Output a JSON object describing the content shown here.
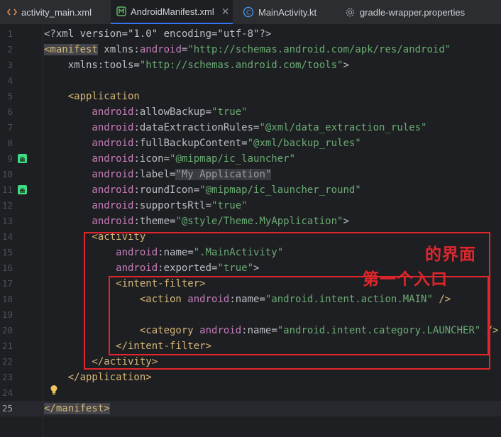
{
  "tabs": [
    {
      "label": "activity_main.xml",
      "icon": "xml-code-icon"
    },
    {
      "label": "AndroidManifest.xml",
      "icon": "manifest-icon",
      "active": true
    },
    {
      "label": "MainActivity.kt",
      "icon": "kotlin-class-icon"
    },
    {
      "label": "gradle-wrapper.properties",
      "icon": "gear-icon"
    }
  ],
  "editor": {
    "current_line": 25,
    "line_numbers": [
      "1",
      "2",
      "3",
      "4",
      "5",
      "6",
      "7",
      "8",
      "9",
      "10",
      "11",
      "12",
      "13",
      "14",
      "15",
      "16",
      "17",
      "18",
      "19",
      "20",
      "21",
      "22",
      "23",
      "24",
      "25"
    ],
    "lines": [
      [
        {
          "t": "<?xml version=\"1.0\" encoding=\"utf-8\"?>",
          "c": "pi"
        }
      ],
      [
        {
          "t": "<manifest",
          "c": "tag hl"
        },
        {
          "t": " xmlns:",
          "c": "attr"
        },
        {
          "t": "android",
          "c": "ns"
        },
        {
          "t": "=",
          "c": "attr"
        },
        {
          "t": "\"http://schemas.android.com/apk/res/android\"",
          "c": "str"
        }
      ],
      [
        {
          "t": "    xmlns:tools=",
          "c": "attr"
        },
        {
          "t": "\"http://schemas.android.com/tools\"",
          "c": "str"
        },
        {
          "t": ">",
          "c": "br"
        }
      ],
      [],
      [
        {
          "t": "    <application",
          "c": "tag"
        }
      ],
      [
        {
          "t": "        android",
          "c": "ns"
        },
        {
          "t": ":allowBackup=",
          "c": "attr"
        },
        {
          "t": "\"true\"",
          "c": "str"
        }
      ],
      [
        {
          "t": "        android",
          "c": "ns"
        },
        {
          "t": ":dataExtractionRules=",
          "c": "attr"
        },
        {
          "t": "\"@xml/data_extraction_rules\"",
          "c": "str"
        }
      ],
      [
        {
          "t": "        android",
          "c": "ns"
        },
        {
          "t": ":fullBackupContent=",
          "c": "attr"
        },
        {
          "t": "\"@xml/backup_rules\"",
          "c": "str"
        }
      ],
      [
        {
          "t": "        android",
          "c": "ns"
        },
        {
          "t": ":icon=",
          "c": "attr"
        },
        {
          "t": "\"@mipmap/ic_launcher\"",
          "c": "str"
        }
      ],
      [
        {
          "t": "        android",
          "c": "ns"
        },
        {
          "t": ":label=",
          "c": "attr"
        },
        {
          "t": "\"My Application\"",
          "c": "strhl"
        }
      ],
      [
        {
          "t": "        android",
          "c": "ns"
        },
        {
          "t": ":roundIcon=",
          "c": "attr"
        },
        {
          "t": "\"@mipmap/ic_launcher_round\"",
          "c": "str"
        }
      ],
      [
        {
          "t": "        android",
          "c": "ns"
        },
        {
          "t": ":supportsRtl=",
          "c": "attr"
        },
        {
          "t": "\"true\"",
          "c": "str"
        }
      ],
      [
        {
          "t": "        android",
          "c": "ns"
        },
        {
          "t": ":theme=",
          "c": "attr"
        },
        {
          "t": "\"@style/Theme.MyApplication\"",
          "c": "str"
        },
        {
          "t": ">",
          "c": "br"
        }
      ],
      [
        {
          "t": "        <activity",
          "c": "tag"
        }
      ],
      [
        {
          "t": "            android",
          "c": "ns"
        },
        {
          "t": ":name=",
          "c": "attr"
        },
        {
          "t": "\".MainActivity\"",
          "c": "str"
        }
      ],
      [
        {
          "t": "            android",
          "c": "ns"
        },
        {
          "t": ":exported=",
          "c": "attr"
        },
        {
          "t": "\"true\"",
          "c": "str"
        },
        {
          "t": ">",
          "c": "br"
        }
      ],
      [
        {
          "t": "            <intent-filter>",
          "c": "tag"
        }
      ],
      [
        {
          "t": "                <action ",
          "c": "tag"
        },
        {
          "t": "android",
          "c": "ns"
        },
        {
          "t": ":name=",
          "c": "attr"
        },
        {
          "t": "\"android.intent.action.MAIN\"",
          "c": "str"
        },
        {
          "t": " />",
          "c": "tag"
        }
      ],
      [],
      [
        {
          "t": "                <category ",
          "c": "tag"
        },
        {
          "t": "android",
          "c": "ns"
        },
        {
          "t": ":name=",
          "c": "attr"
        },
        {
          "t": "\"android.intent.category.LAUNCHER\"",
          "c": "str"
        },
        {
          "t": " />",
          "c": "tag"
        }
      ],
      [
        {
          "t": "            </intent-filter>",
          "c": "tag"
        }
      ],
      [
        {
          "t": "        </activity>",
          "c": "tag"
        }
      ],
      [
        {
          "t": "    </application>",
          "c": "tag"
        }
      ],
      [],
      [
        {
          "t": "</manifest>",
          "c": "tag hl"
        }
      ]
    ],
    "gutter_icons": [
      {
        "line": 9,
        "icon": "android-icon"
      },
      {
        "line": 11,
        "icon": "android-icon"
      },
      {
        "line": 24,
        "icon": "lightbulb-icon"
      }
    ]
  },
  "annotations": {
    "label_1": "的界面",
    "label_2": "第一个入口",
    "color": "#e0262b"
  }
}
